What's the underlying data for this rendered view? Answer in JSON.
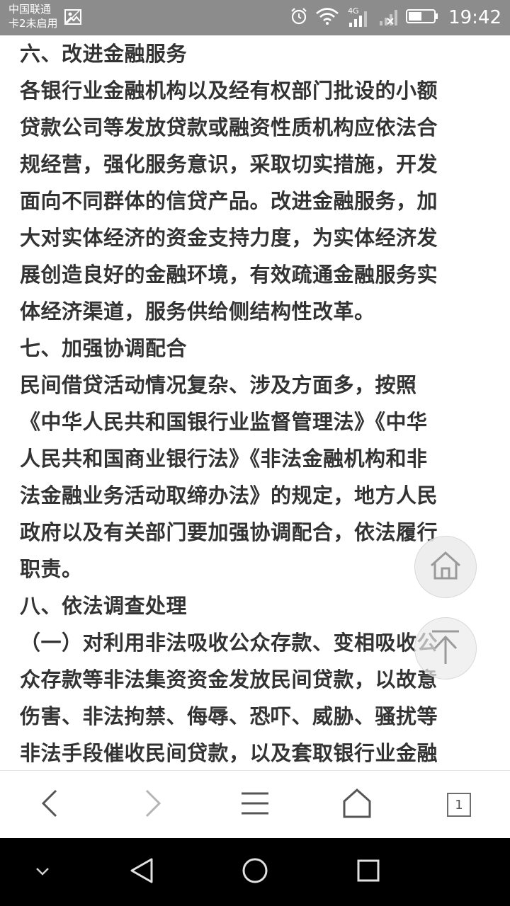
{
  "status_bar": {
    "carrier_line1": "中国联通",
    "carrier_line2": "卡2未启用",
    "network_type": "4G",
    "time": "19:42"
  },
  "article": {
    "lines": [
      "六、改进金融服务",
      "各银行业金融机构以及经有权部门批设的小额",
      "贷款公司等发放贷款或融资性质机构应依法合",
      "规经营，强化服务意识，采取切实措施，开发",
      "面向不同群体的信贷产品。改进金融服务，加",
      "大对实体经济的资金支持力度，为实体经济发",
      "展创造良好的金融环境，有效疏通金融服务实",
      "体经济渠道，服务供给侧结构性改革。",
      "七、加强协调配合",
      "民间借贷活动情况复杂、涉及方面多，按照",
      "《中华人民共和国银行业监督管理法》《中华",
      "人民共和国商业银行法》《非法金融机构和非",
      "法金融业务活动取缔办法》的规定，地方人民",
      "政府以及有关部门要加强协调配合，依法履行",
      "职责。",
      "八、依法调查处理",
      "（一）对利用非法吸收公众存款、变相吸收公",
      "众存款等非法集资资金发放民间贷款，以故意",
      "伤害、非法拘禁、侮辱、恐吓、威胁、骚扰等",
      "非法手段催收民间贷款，以及套取银行业金融"
    ]
  },
  "toolbar": {
    "tab_count": "1"
  },
  "colors": {
    "status_bar_bg": "#8c8c8c",
    "text": "#333333",
    "nav_bar_bg": "#000000"
  }
}
